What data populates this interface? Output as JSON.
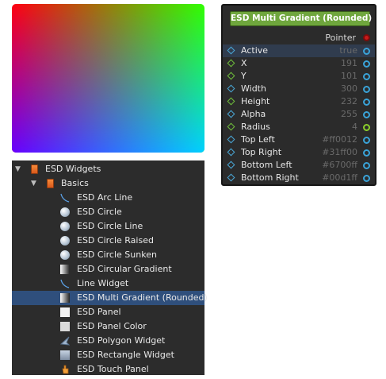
{
  "node": {
    "title": "ESD Multi Gradient (Rounded)",
    "output_label": "Pointer",
    "properties": [
      {
        "name": "Active",
        "value": "true",
        "port": "blue",
        "diamond": "blue"
      },
      {
        "name": "X",
        "value": "191",
        "port": "blue",
        "diamond": "green"
      },
      {
        "name": "Y",
        "value": "101",
        "port": "blue",
        "diamond": "green"
      },
      {
        "name": "Width",
        "value": "300",
        "port": "blue",
        "diamond": "blue"
      },
      {
        "name": "Height",
        "value": "232",
        "port": "blue",
        "diamond": "green"
      },
      {
        "name": "Alpha",
        "value": "255",
        "port": "blue",
        "diamond": "blue"
      },
      {
        "name": "Radius",
        "value": "4",
        "port": "green",
        "diamond": "green"
      },
      {
        "name": "Top Left",
        "value": "#ff0012",
        "port": "blue",
        "diamond": "blue"
      },
      {
        "name": "Top Right",
        "value": "#31ff00",
        "port": "blue",
        "diamond": "blue"
      },
      {
        "name": "Bottom Left",
        "value": "#6700ff",
        "port": "blue",
        "diamond": "blue"
      },
      {
        "name": "Bottom Right",
        "value": "#00d1ff",
        "port": "blue",
        "diamond": "blue"
      }
    ]
  },
  "gradient_colors": {
    "top_left": "#ff0012",
    "top_right": "#31ff00",
    "bottom_left": "#6700ff",
    "bottom_right": "#00d1ff"
  },
  "tree": {
    "root": {
      "label": "ESD Widgets",
      "icon": "folder-icon"
    },
    "group": {
      "label": "Basics",
      "icon": "folder-icon"
    },
    "items": [
      {
        "label": "ESD Arc Line",
        "icon": "arc-line-icon"
      },
      {
        "label": "ESD Circle",
        "icon": "circle-icon"
      },
      {
        "label": "ESD Circle Line",
        "icon": "circle-icon"
      },
      {
        "label": "ESD Circle Raised",
        "icon": "circle-icon"
      },
      {
        "label": "ESD Circle Sunken",
        "icon": "circle-icon"
      },
      {
        "label": "ESD Circular Gradient",
        "icon": "gradient-icon"
      },
      {
        "label": "Line Widget",
        "icon": "line-icon"
      },
      {
        "label": "ESD Multi Gradient (Rounded)",
        "icon": "gradient-icon"
      },
      {
        "label": "ESD Panel",
        "icon": "panel-icon"
      },
      {
        "label": "ESD Panel Color",
        "icon": "panel-color-icon"
      },
      {
        "label": "ESD Polygon Widget",
        "icon": "polygon-icon"
      },
      {
        "label": "ESD Rectangle Widget",
        "icon": "rectangle-icon"
      },
      {
        "label": "ESD Touch Panel",
        "icon": "hand-icon"
      }
    ],
    "selected_index": 7
  }
}
